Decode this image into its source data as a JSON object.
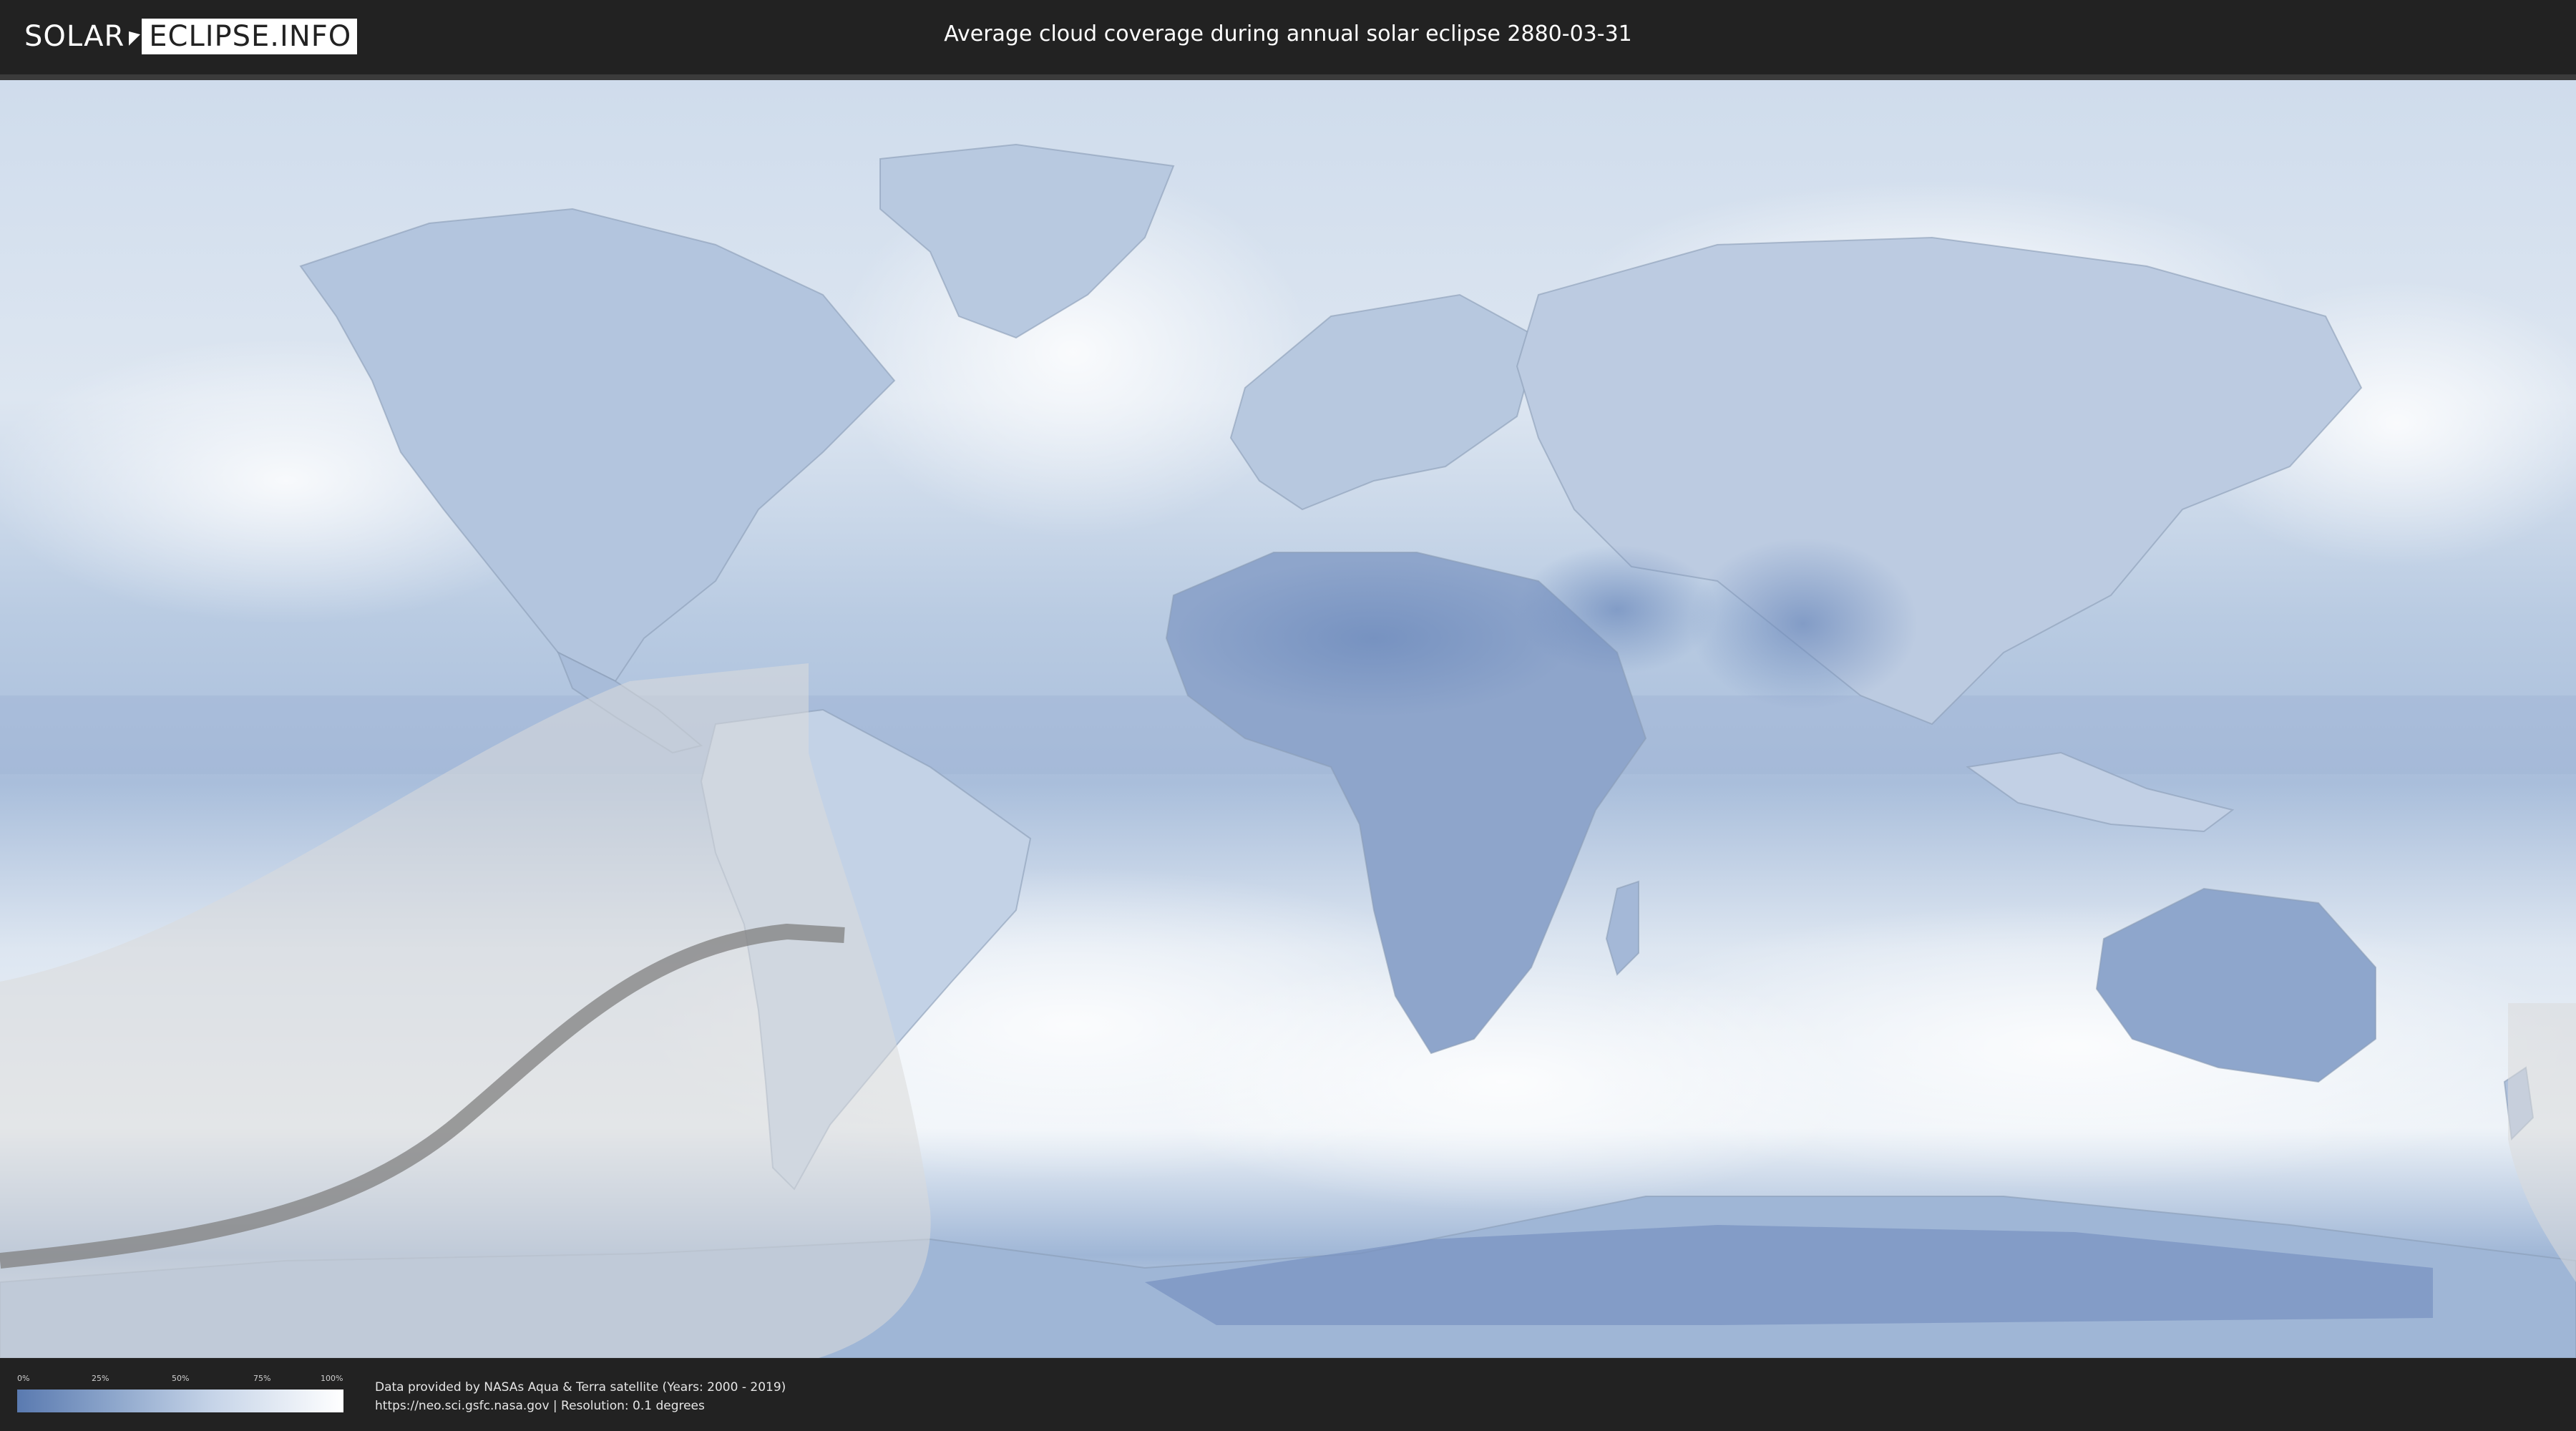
{
  "header": {
    "logo_left": "SOLAR",
    "logo_right": "ECLIPSE.INFO",
    "title": "Average cloud coverage during annual solar eclipse 2880-03-31"
  },
  "legend": {
    "ticks": [
      "0%",
      "25%",
      "50%",
      "75%",
      "100%"
    ],
    "gradient_colors": [
      "#5a7ab0",
      "#8ea7cc",
      "#c6d4e8",
      "#ffffff"
    ]
  },
  "credits": {
    "line1": "Data provided by NASAs Aqua & Terra satellite (Years: 2000 - 2019)",
    "line2": "https://neo.sci.gsfc.nasa.gov | Resolution: 0.1 degrees"
  },
  "colors": {
    "background": "#222222",
    "cloud_low": "#5a7ab0",
    "cloud_high": "#ffffff",
    "eclipse_zone": "#d8d8d8",
    "eclipse_path": "#808080"
  }
}
